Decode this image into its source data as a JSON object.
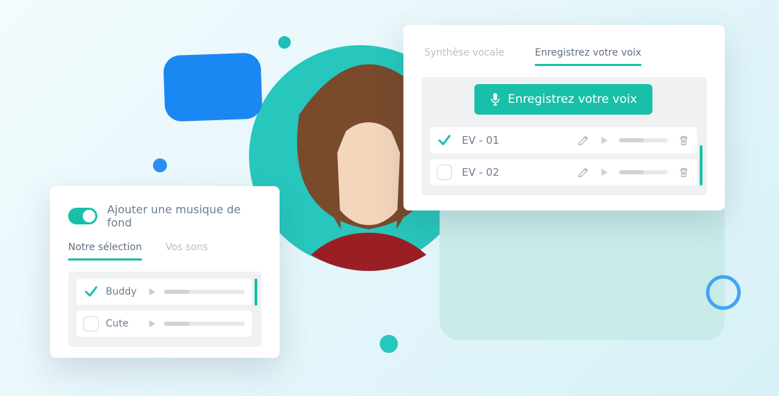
{
  "colors": {
    "accent": "#18bfa9",
    "blue": "#1b87f3",
    "textMuted": "#6d7d92"
  },
  "left_card": {
    "toggle_label": "Ajouter une musique de fond",
    "tabs": {
      "selection": "Notre sélection",
      "yours": "Vos sons",
      "active": "selection"
    },
    "items": [
      {
        "label": "Buddy",
        "checked": true
      },
      {
        "label": "Cute",
        "checked": false
      }
    ]
  },
  "right_card": {
    "tabs": {
      "tts": "Synthèse vocale",
      "record": "Enregistrez votre voix",
      "active": "record"
    },
    "record_button": "Enregistrez votre voix",
    "items": [
      {
        "label": "EV - 01",
        "checked": true
      },
      {
        "label": "EV - 02",
        "checked": false
      }
    ]
  }
}
